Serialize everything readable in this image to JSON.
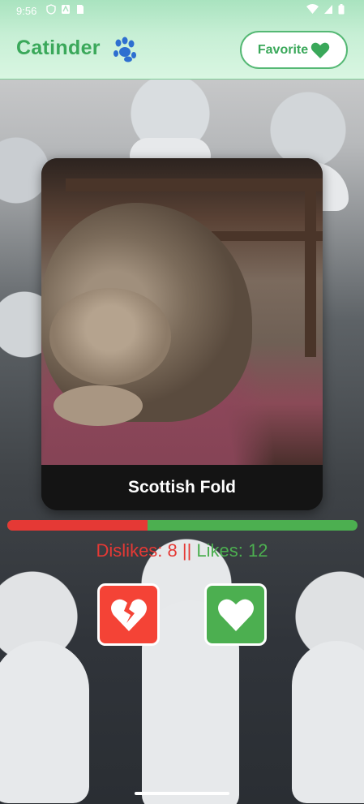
{
  "status_bar": {
    "time": "9:56"
  },
  "header": {
    "title": "Catinder",
    "title_icon": "paw-icon",
    "favorite_label": "Favorite",
    "favorite_icon": "heart-icon"
  },
  "card": {
    "breed": "Scottish Fold"
  },
  "stats": {
    "dislikes_label": "Dislikes: 8",
    "separator": " || ",
    "likes_label": "Likes: 12",
    "dislikes": 8,
    "likes": 12,
    "dislike_fraction": 0.4
  },
  "actions": {
    "dislike_icon": "broken-heart-icon",
    "like_icon": "heart-icon"
  },
  "colors": {
    "brand_green": "#3aa85a",
    "like_green": "#4caf50",
    "dislike_red": "#e53935"
  }
}
